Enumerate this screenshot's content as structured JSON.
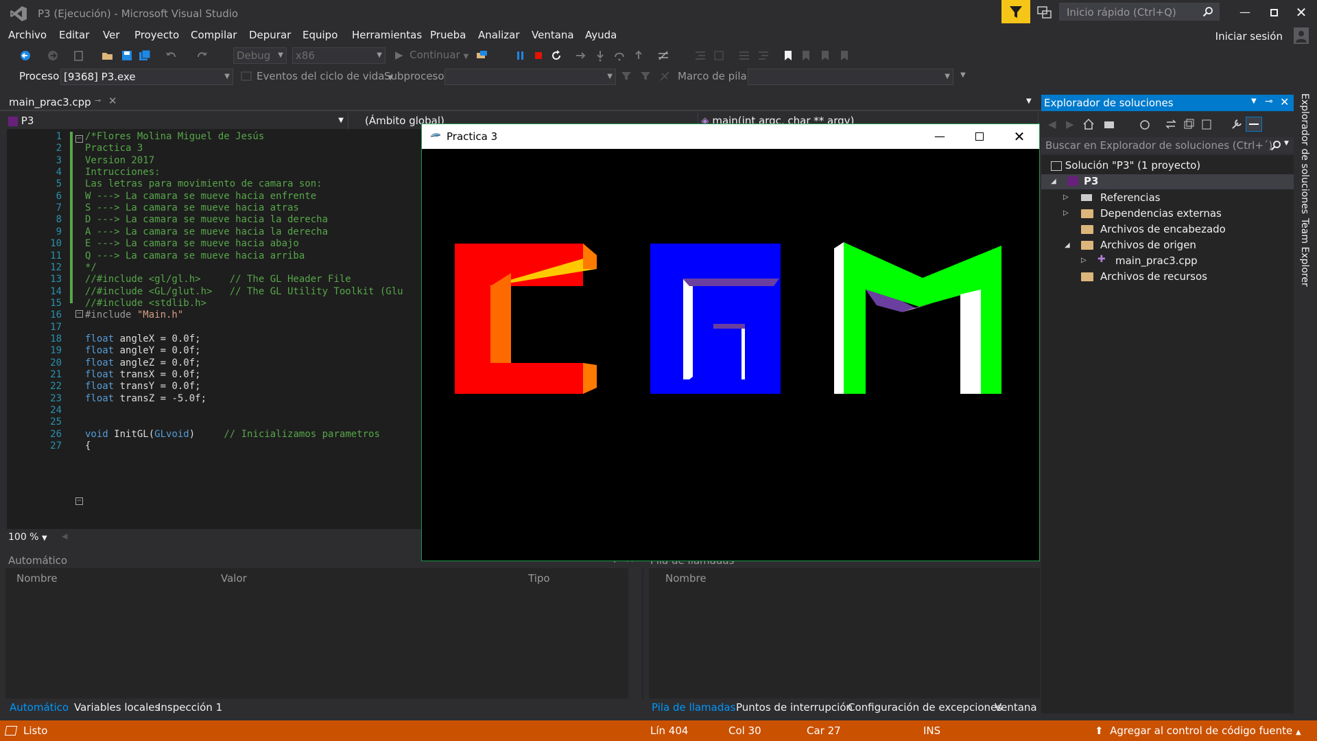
{
  "titlebar": {
    "title": "P3 (Ejecución) - Microsoft Visual Studio",
    "quicklaunch_placeholder": "Inicio rápido (Ctrl+Q)"
  },
  "menu": [
    "Archivo",
    "Editar",
    "Ver",
    "Proyecto",
    "Compilar",
    "Depurar",
    "Equipo",
    "Herramientas",
    "Prueba",
    "Analizar",
    "Ventana",
    "Ayuda"
  ],
  "account": {
    "signin": "Iniciar sesión"
  },
  "toolbar1": {
    "config": "Debug",
    "platform": "x86",
    "continue": "Continuar"
  },
  "toolbar2": {
    "process_label": "Proceso:",
    "process_value": "[9368] P3.exe",
    "lifecycle": "Eventos del ciclo de vida",
    "thread_label": "Subproceso:",
    "stackframe_label": "Marco de pila:"
  },
  "editor": {
    "tab": "main_prac3.cpp",
    "nav_project": "P3",
    "nav_scope": "(Ámbito global)",
    "nav_member": "main(int argc, char ** argv)",
    "zoom": "100 %",
    "lines": [
      {
        "n": "1",
        "parts": [
          {
            "c": "cm",
            "t": "/*Flores Molina Miguel de Jesús"
          }
        ]
      },
      {
        "n": "2",
        "parts": [
          {
            "c": "cm",
            "t": "Practica 3"
          }
        ]
      },
      {
        "n": "3",
        "parts": [
          {
            "c": "cm",
            "t": "Version 2017"
          }
        ]
      },
      {
        "n": "4",
        "parts": [
          {
            "c": "cm",
            "t": "Intrucciones:"
          }
        ]
      },
      {
        "n": "5",
        "parts": [
          {
            "c": "cm",
            "t": "Las letras para movimiento de camara son:"
          }
        ]
      },
      {
        "n": "6",
        "parts": [
          {
            "c": "cm",
            "t": "W ---> La camara se mueve hacia enfrente"
          }
        ]
      },
      {
        "n": "7",
        "parts": [
          {
            "c": "cm",
            "t": "S ---> La camara se mueve hacia atras"
          }
        ]
      },
      {
        "n": "8",
        "parts": [
          {
            "c": "cm",
            "t": "D ---> La camara se mueve hacia la derecha"
          }
        ]
      },
      {
        "n": "9",
        "parts": [
          {
            "c": "cm",
            "t": "A ---> La camara se mueve hacia la derecha"
          }
        ]
      },
      {
        "n": "10",
        "parts": [
          {
            "c": "cm",
            "t": "E ---> La camara se mueve hacia abajo"
          }
        ]
      },
      {
        "n": "11",
        "parts": [
          {
            "c": "cm",
            "t": "Q ---> La camara se mueve hacia arriba"
          }
        ]
      },
      {
        "n": "12",
        "parts": [
          {
            "c": "cm",
            "t": "*/"
          }
        ]
      },
      {
        "n": "13",
        "parts": [
          {
            "c": "cm",
            "t": "//#include <gl/gl.h>     // The GL Header File"
          }
        ]
      },
      {
        "n": "14",
        "parts": [
          {
            "c": "cm",
            "t": "//#include <GL/glut.h>   // The GL Utility Toolkit (Glu"
          }
        ]
      },
      {
        "n": "15",
        "parts": [
          {
            "c": "cm",
            "t": "//#include <stdlib.h>"
          }
        ]
      },
      {
        "n": "16",
        "parts": [
          {
            "c": "pp",
            "t": "#include "
          },
          {
            "c": "st",
            "t": "\"Main.h\""
          }
        ]
      },
      {
        "n": "17",
        "parts": []
      },
      {
        "n": "18",
        "parts": [
          {
            "c": "kw",
            "t": "float"
          },
          {
            "c": "tx",
            "t": " angleX = 0.0f;"
          }
        ]
      },
      {
        "n": "19",
        "parts": [
          {
            "c": "kw",
            "t": "float"
          },
          {
            "c": "tx",
            "t": " angleY = 0.0f;"
          }
        ]
      },
      {
        "n": "20",
        "parts": [
          {
            "c": "kw",
            "t": "float"
          },
          {
            "c": "tx",
            "t": " angleZ = 0.0f;"
          }
        ]
      },
      {
        "n": "21",
        "parts": [
          {
            "c": "kw",
            "t": "float"
          },
          {
            "c": "tx",
            "t": " transX = 0.0f;"
          }
        ]
      },
      {
        "n": "22",
        "parts": [
          {
            "c": "kw",
            "t": "float"
          },
          {
            "c": "tx",
            "t": " transY = 0.0f;"
          }
        ]
      },
      {
        "n": "23",
        "parts": [
          {
            "c": "kw",
            "t": "float"
          },
          {
            "c": "tx",
            "t": " transZ = -5.0f;"
          }
        ]
      },
      {
        "n": "24",
        "parts": []
      },
      {
        "n": "25",
        "parts": []
      },
      {
        "n": "26",
        "parts": [
          {
            "c": "kw",
            "t": "void"
          },
          {
            "c": "tx",
            "t": " InitGL("
          },
          {
            "c": "kw",
            "t": "GLvoid"
          },
          {
            "c": "tx",
            "t": ")     "
          },
          {
            "c": "cm",
            "t": "// Inicializamos parametros"
          }
        ]
      },
      {
        "n": "27",
        "parts": [
          {
            "c": "tx",
            "t": "{"
          }
        ]
      }
    ]
  },
  "auto_panel": {
    "title": "Automático",
    "col_name": "Nombre",
    "col_value": "Valor",
    "col_type": "Tipo"
  },
  "calls_panel": {
    "title": "Pila de llamadas",
    "col_name": "Nombre"
  },
  "bottom_tabs_left": [
    "Automático",
    "Variables locales",
    "Inspección 1"
  ],
  "bottom_tabs_right": [
    "Pila de llamadas",
    "Puntos de interrupción",
    "Configuración de excepciones",
    "Ventana C"
  ],
  "solution": {
    "title": "Explorador de soluciones",
    "search_placeholder": "Buscar en Explorador de soluciones (Ctrl+´)",
    "root": "Solución \"P3\"  (1 proyecto)",
    "project": "P3",
    "items": [
      "Referencias",
      "Dependencias externas",
      "Archivos de encabezado",
      "Archivos de origen",
      "main_prac3.cpp",
      "Archivos de recursos"
    ]
  },
  "side_tabs": [
    "Explorador de soluciones",
    "Team Explorer"
  ],
  "practica": {
    "title": "Practica 3"
  },
  "status": {
    "state": "Listo",
    "line": "Lín 404",
    "col": "Col 30",
    "car": "Car 27",
    "ins": "INS",
    "source_control": "Agregar al control de código fuente"
  },
  "colors": {
    "accent": "#007acc",
    "status_debug": "#ca5100",
    "letter_c": "#ff0000",
    "letter_g": "#0000ff",
    "letter_m": "#00ff00"
  }
}
